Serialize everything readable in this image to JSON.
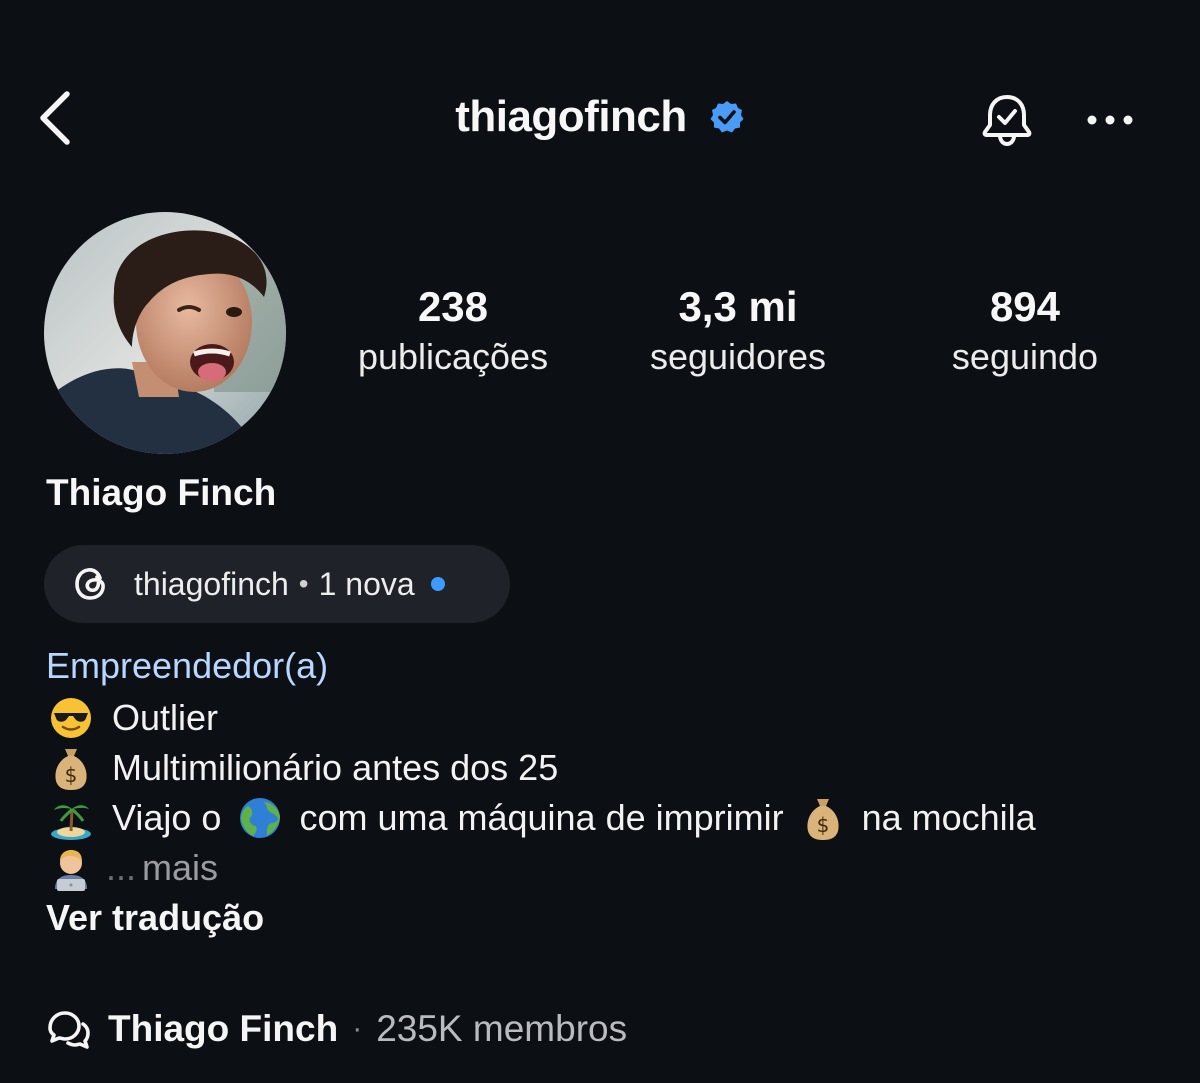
{
  "header": {
    "username": "thiagofinch",
    "verified": true,
    "accent_color": "#4a9bf5"
  },
  "profile": {
    "display_name": "Thiago Finch",
    "stats": [
      {
        "count": "238",
        "label": "publicações"
      },
      {
        "count": "3,3 mi",
        "label": "seguidores"
      },
      {
        "count": "894",
        "label": "seguindo"
      }
    ]
  },
  "threads_pill": {
    "handle": "thiagofinch",
    "separator": "•",
    "status": "1 nova",
    "icon": "threads-icon"
  },
  "bio": {
    "category": "Empreendedor(a)",
    "line1": "Outlier",
    "line2": "Multimilionário antes dos 25",
    "line3_a": "Viajo o",
    "line3_b": "com uma máquina de imprimir",
    "line3_c": "na mochila",
    "line4_ellipsis": "...",
    "more": "mais",
    "translate": "Ver tradução",
    "emojis": [
      "sunglasses-emoji",
      "money-bag-emoji",
      "desert-island-emoji",
      "globe-emoji",
      "money-bag-emoji",
      "technologist-emoji"
    ]
  },
  "community": {
    "name": "Thiago Finch",
    "separator": "·",
    "members": "235K membros",
    "icon": "community-chat-icon"
  }
}
